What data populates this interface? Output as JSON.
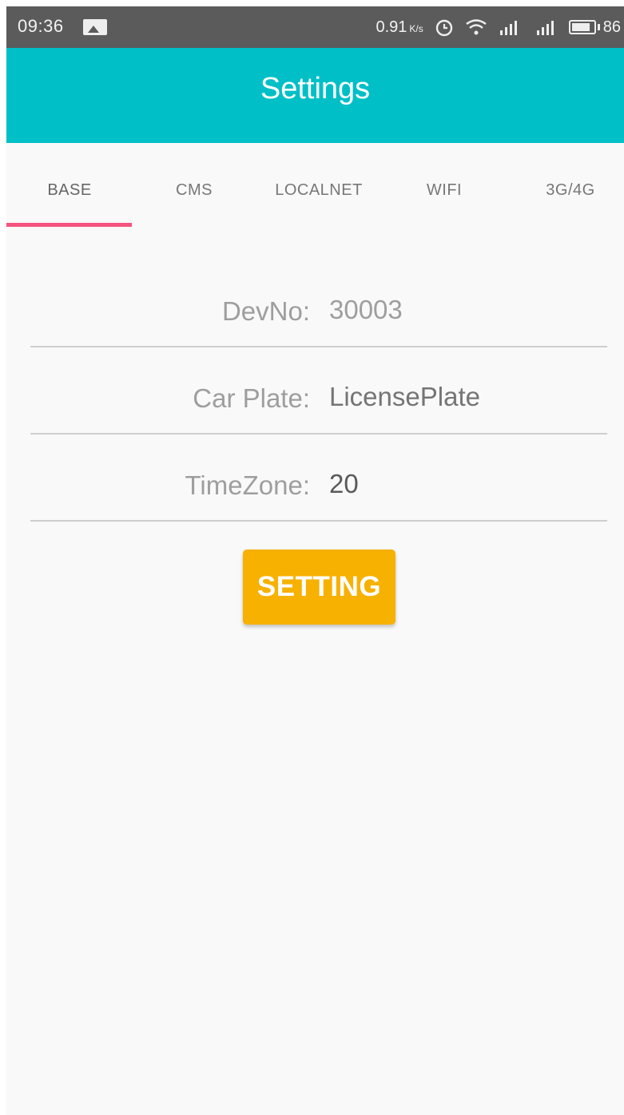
{
  "status_bar": {
    "time": "09:36",
    "net_speed": "0.91",
    "net_unit": "K/s",
    "battery": "86",
    "icons": [
      "image-icon",
      "alarm-icon",
      "wifi-icon",
      "signal-icon",
      "signal-icon",
      "battery-icon"
    ]
  },
  "toolbar": {
    "title": "Settings"
  },
  "tabs": [
    {
      "label": "BASE",
      "active": true
    },
    {
      "label": "CMS",
      "active": false
    },
    {
      "label": "LOCALNET",
      "active": false
    },
    {
      "label": "WIFI",
      "active": false
    },
    {
      "label": "3G/4G",
      "active": false
    }
  ],
  "form": {
    "devno": {
      "label": "DevNo:",
      "value": "30003"
    },
    "car_plate": {
      "label": "Car Plate:",
      "placeholder": "LicensePlate",
      "value": ""
    },
    "timezone": {
      "label": "TimeZone:",
      "value": "20"
    }
  },
  "setting_button": {
    "label": "SETTING"
  },
  "colors": {
    "toolbar": "#00bfc7",
    "tab_indicator": "#f4547e",
    "button": "#f7b100"
  }
}
